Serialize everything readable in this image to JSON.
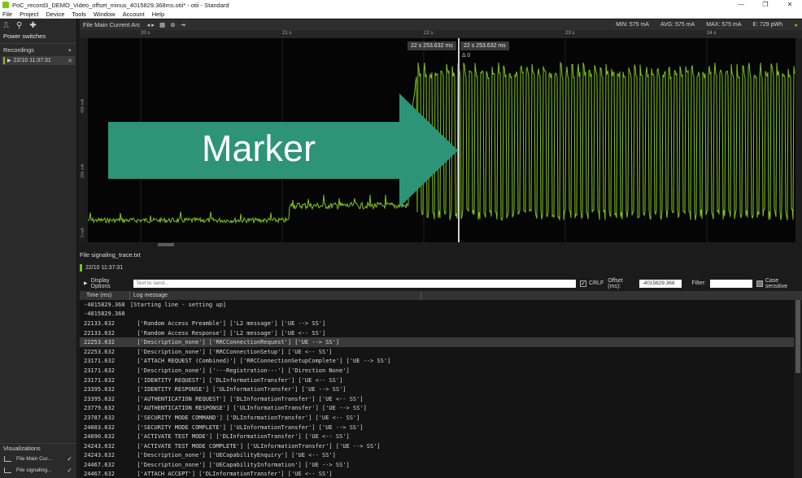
{
  "window": {
    "title": "PoC_record3_DEMO_Video_offset_minus_4015829.368ms.otii* - otii - Standard",
    "buttons": [
      "—",
      "❐",
      "✕"
    ]
  },
  "menu": [
    "File",
    "Project",
    "Device",
    "Tools",
    "Window",
    "Account",
    "Help"
  ],
  "sidebar": {
    "power_switches": "Power switches",
    "recordings_label": "Recordings",
    "recordings": [
      {
        "label": "22/10 11:37:31"
      }
    ],
    "visualizations_label": "Visualizations",
    "visualizations": [
      {
        "label": "File Main Cur..."
      },
      {
        "label": "File signaling..."
      }
    ]
  },
  "plot": {
    "title": "File Main Current Arc",
    "stats": {
      "min": "MIN: 575 mA",
      "avg": "AVG: 575 mA",
      "max": "MAX: 575 mA",
      "energy": "E: 729 pWh"
    },
    "time_ticks": [
      "20 s",
      "21 s",
      "22 s",
      "23 s",
      "24 s"
    ],
    "y_ticks": [
      "400 mA",
      "200 mA",
      "0 mA"
    ],
    "marker_time_1": "22 s 253.632 ms",
    "marker_time_2": "22 s 253.632 ms",
    "marker_delta": "Δ 0",
    "overlay_label": "Marker",
    "colors": {
      "trace": "#7fc31c",
      "overlay": "#2e9477"
    }
  },
  "signaling": {
    "file_title": "File signaling_trace.txt",
    "recording": "22/10 11:37:31",
    "display_options": "Display Options",
    "send_placeholder": "Text to send...",
    "crlf": "CRLF",
    "offset_label": "Offset (ms):",
    "offset_value": "-4015829.368",
    "filter_label": "Filter:",
    "case_sensitive": "Case sensitive",
    "col_time": "Time (ms)",
    "col_msg": "Log message",
    "rows": [
      {
        "t": "-4015829.368",
        "m": "[Starting line - setting up]"
      },
      {
        "t": "-4015829.368",
        "m": ""
      },
      {
        "t": "22133.632",
        "m": "  ['Random Access Preamble'] ['L2 message'] ['UE --> SS']"
      },
      {
        "t": "22133.632",
        "m": "  ['Random Access Response'] ['L2 message'] ['UE <-- SS']"
      },
      {
        "t": "22253.632",
        "m": "  ['Description_none'] ['RRCConnectionRequest'] ['UE --> SS']"
      },
      {
        "t": "22253.632",
        "m": "  ['Description_none'] ['RRCConnectionSetup'] ['UE <-- SS']"
      },
      {
        "t": "23171.632",
        "m": "  ['ATTACH REQUEST (Combined)'] ['RRCConnectionSetupComplete'] ['UE --> SS']"
      },
      {
        "t": "23171.632",
        "m": "  ['Description_none'] ['---Registration---'] ['Direction None']"
      },
      {
        "t": "23171.632",
        "m": "  ['IDENTITY REQUEST'] ['DLInformationTransfer'] ['UE <-- SS']"
      },
      {
        "t": "23395.632",
        "m": "  ['IDENTITY RESPONSE'] ['ULInformationTransfer'] ['UE --> SS']"
      },
      {
        "t": "23395.632",
        "m": "  ['AUTHENTICATION REQUEST'] ['DLInformationTransfer'] ['UE <-- SS']"
      },
      {
        "t": "23779.632",
        "m": "  ['AUTHENTICATION RESPONSE'] ['ULInformationTransfer'] ['UE --> SS']"
      },
      {
        "t": "23787.632",
        "m": "  ['SECURITY MODE COMMAND'] ['DLInformationTransfer'] ['UE <-- SS']"
      },
      {
        "t": "24083.632",
        "m": "  ['SECURITY MODE COMPLETE'] ['ULInformationTransfer'] ['UE --> SS']"
      },
      {
        "t": "24090.632",
        "m": "  ['ACTIVATE TEST MODE'] ['DLInformationTransfer'] ['UE <-- SS']"
      },
      {
        "t": "24243.632",
        "m": "  ['ACTIVATE TEST MODE COMPLETE'] ['ULInformationTransfer'] ['UE --> SS']"
      },
      {
        "t": "24243.632",
        "m": "  ['Description_none'] ['UECapabilityEnquiry'] ['UE <-- SS']"
      },
      {
        "t": "24467.632",
        "m": "  ['Description_none'] ['UECapabilityInformation'] ['UE --> SS']"
      },
      {
        "t": "24467.632",
        "m": "  ['ATTACH ACCEPT'] ['DLInformationTransfer'] ['UE <-- SS']"
      }
    ],
    "selected_row": 4
  }
}
